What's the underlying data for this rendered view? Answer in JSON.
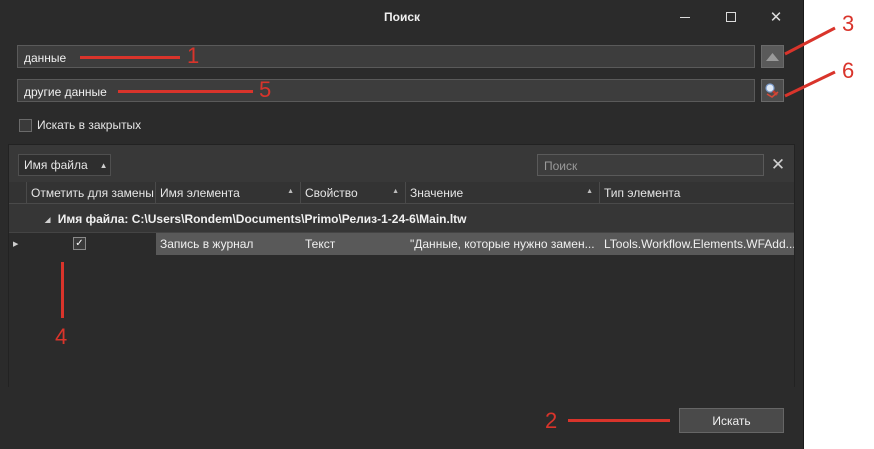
{
  "window": {
    "title": "Поиск"
  },
  "search_field": {
    "value": "данные"
  },
  "replace_field": {
    "value": "другие данные"
  },
  "options": {
    "search_closed_label": "Искать в закрытых"
  },
  "panel": {
    "group_by_label": "Имя файла",
    "search_placeholder": "Поиск"
  },
  "grid": {
    "columns": [
      "Отметить для замены",
      "Имя элемента",
      "Свойство",
      "Значение",
      "Тип элемента"
    ],
    "group_row": "Имя файла: C:\\Users\\Rondem\\Documents\\Primo\\Релиз-1-24-6\\Main.ltw",
    "rows": [
      {
        "checked": true,
        "element_name": "Запись в журнал",
        "property": "Текст",
        "value": "\"Данные, которые нужно замен...",
        "element_type": "LTools.Workflow.Elements.WFAdd..."
      }
    ]
  },
  "footer": {
    "search_button": "Искать"
  },
  "annotations": {
    "labels": [
      "1",
      "2",
      "3",
      "4",
      "5",
      "6"
    ],
    "color": "#d9342b"
  },
  "icons": [
    "minimize-icon",
    "maximize-icon",
    "close-icon",
    "collapse-up-icon",
    "replace-icon",
    "clear-icon",
    "checkmark-icon",
    "sort-asc-icon",
    "row-pointer-icon",
    "group-expander-icon"
  ]
}
